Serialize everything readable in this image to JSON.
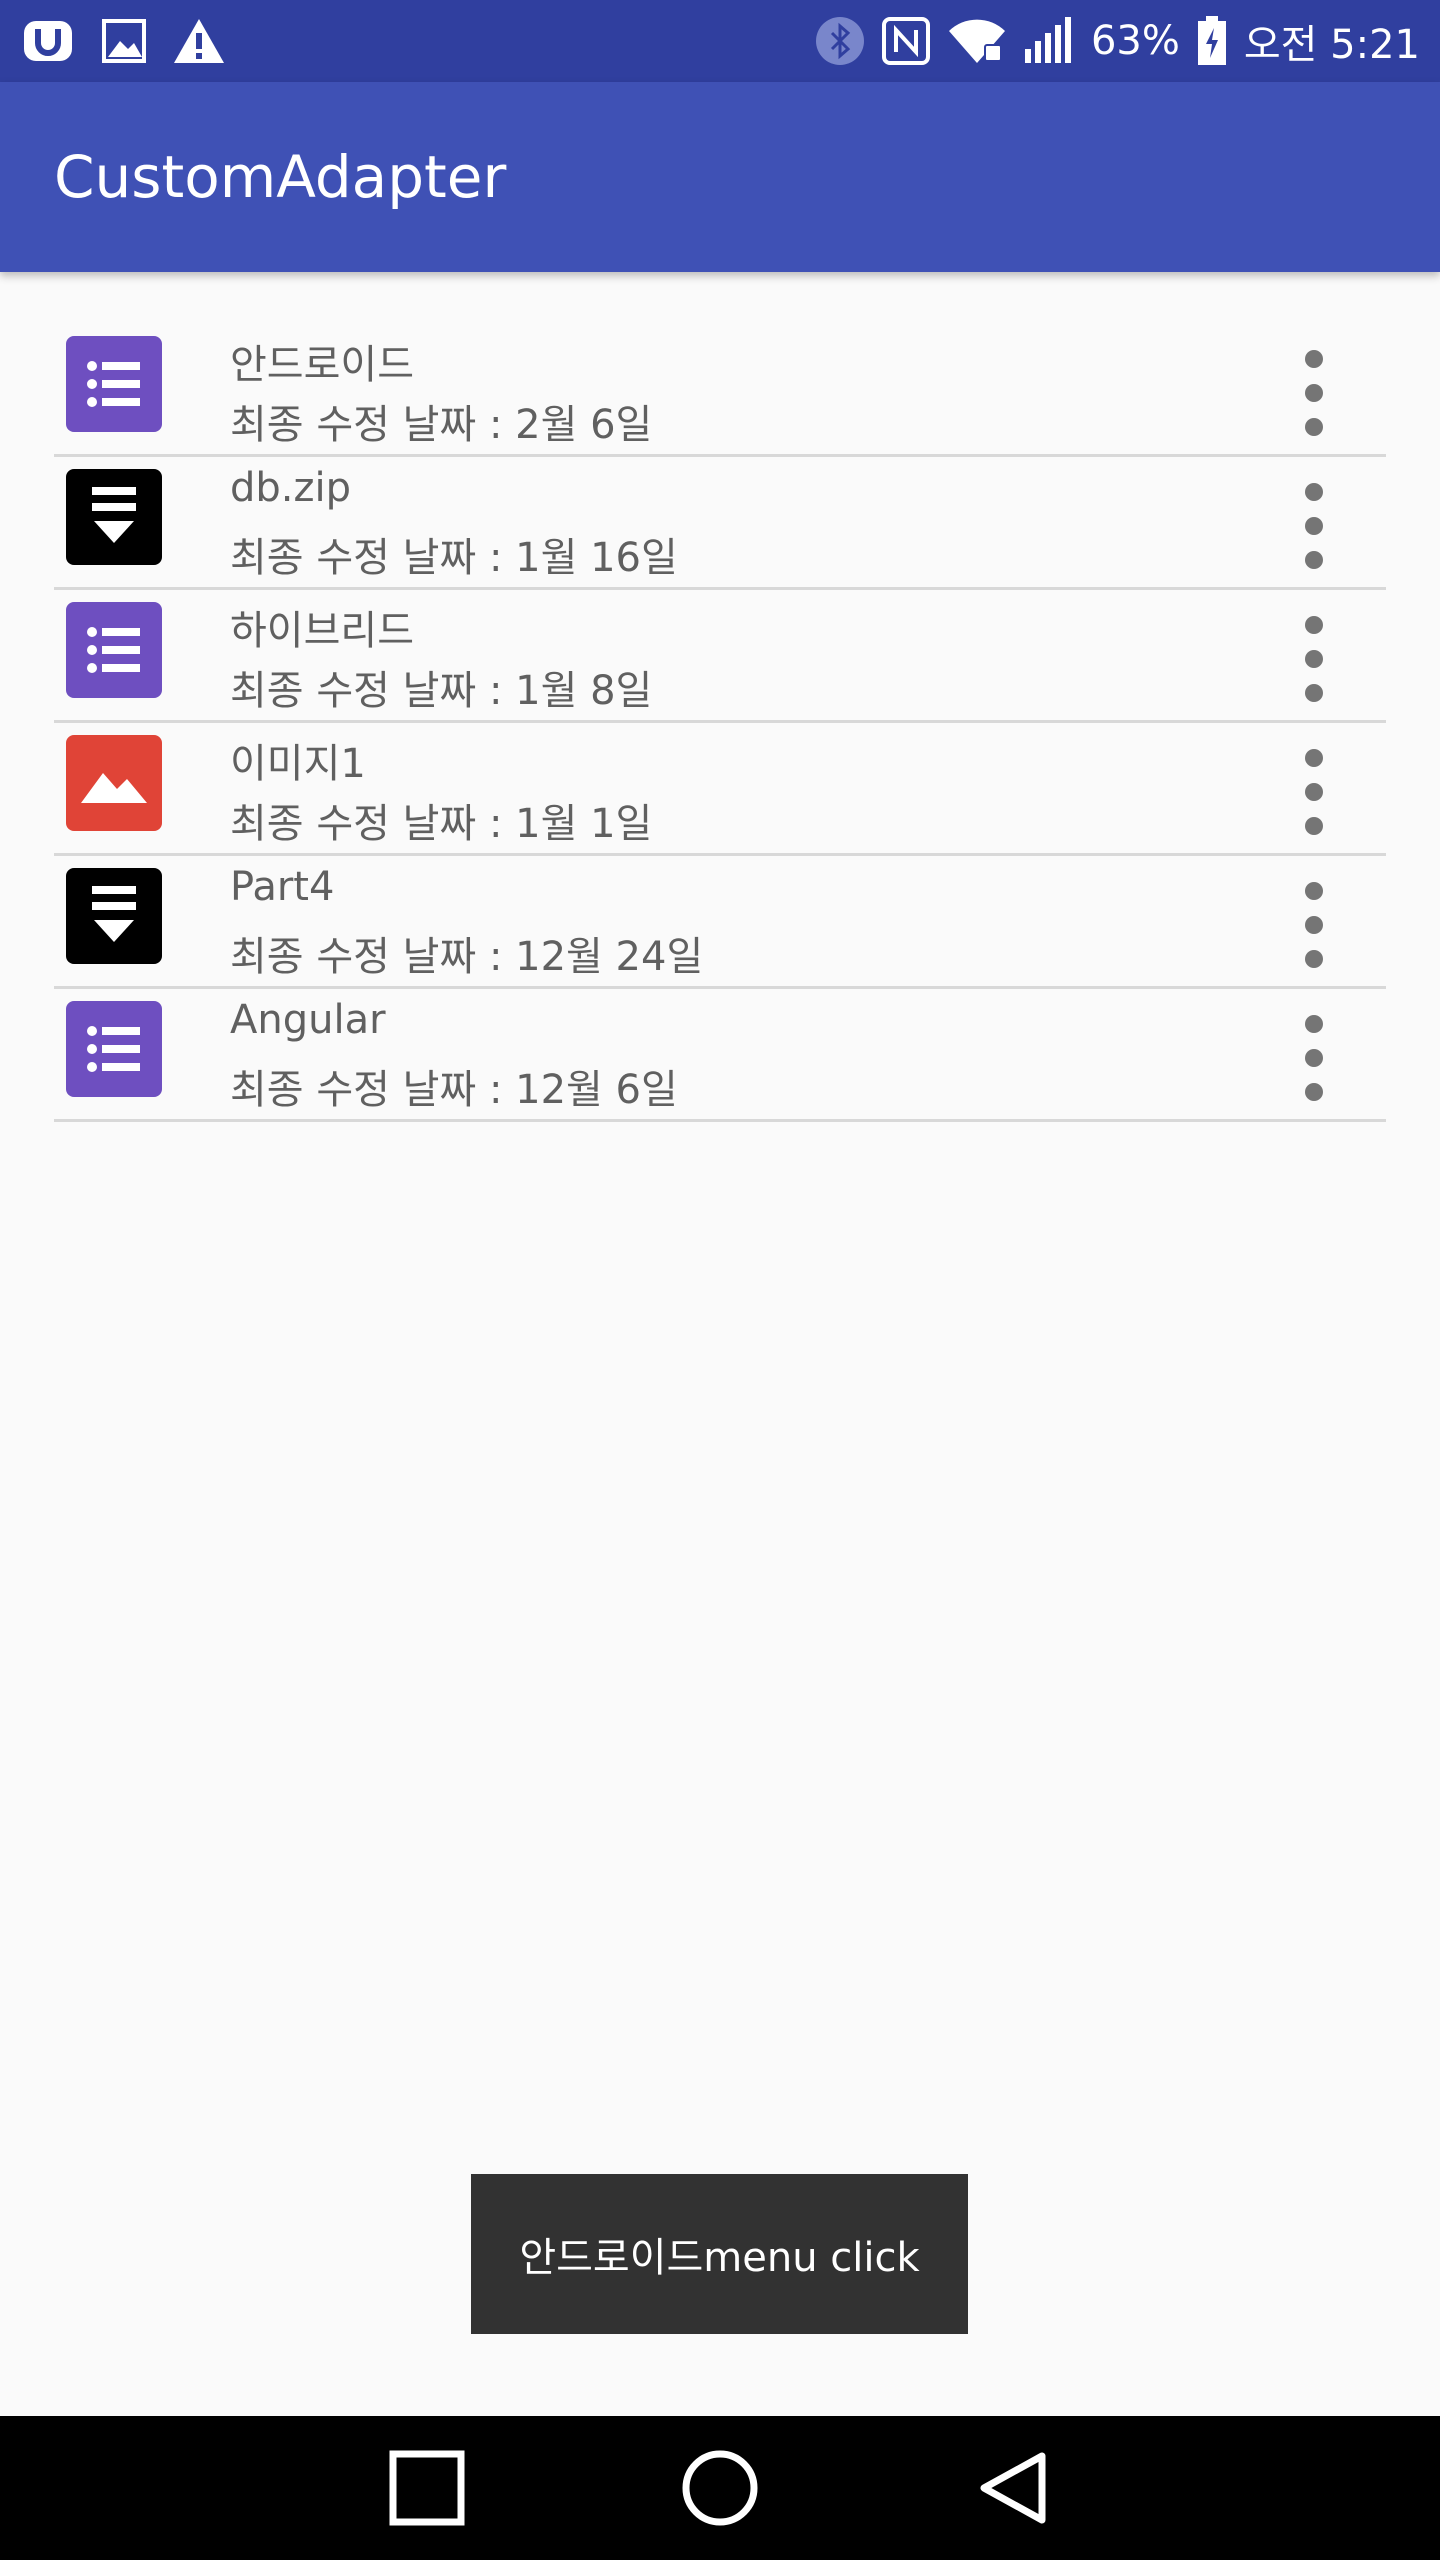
{
  "status_bar": {
    "battery": "63%",
    "time": "오전 5:21",
    "icons": [
      "app-u-icon",
      "gallery-icon",
      "warning-icon",
      "bluetooth-icon",
      "nfc-icon",
      "wifi-icon",
      "signal-icon",
      "battery-icon"
    ]
  },
  "app_bar": {
    "title": "CustomAdapter"
  },
  "list": {
    "items": [
      {
        "title": "안드로이드",
        "subtitle": "최종 수정 날짜 : 2월 6일",
        "icon": "document-list-icon",
        "icon_color": "#6e4fc0"
      },
      {
        "title": "db.zip",
        "subtitle": "최종 수정 날짜 : 1월 16일",
        "icon": "archive-download-icon",
        "icon_color": "#000000"
      },
      {
        "title": "하이브리드",
        "subtitle": "최종 수정 날짜 : 1월 8일",
        "icon": "document-list-icon",
        "icon_color": "#6e4fc0"
      },
      {
        "title": "이미지1",
        "subtitle": "최종 수정 날짜 : 1월 1일",
        "icon": "image-icon",
        "icon_color": "#e04437"
      },
      {
        "title": "Part4",
        "subtitle": "최종 수정 날짜 : 12월 24일",
        "icon": "archive-download-icon",
        "icon_color": "#000000"
      },
      {
        "title": "Angular",
        "subtitle": "최종 수정 날짜 : 12월 6일",
        "icon": "document-list-icon",
        "icon_color": "#6e4fc0"
      }
    ]
  },
  "toast": {
    "text": "안드로이드menu click"
  },
  "nav_bar": {
    "icons": [
      "recents-square-icon",
      "home-circle-icon",
      "back-triangle-icon"
    ]
  },
  "colors": {
    "status_bar": "#303f9f",
    "app_bar": "#3f51b5",
    "background": "#fafafa",
    "toast": "#323232"
  }
}
